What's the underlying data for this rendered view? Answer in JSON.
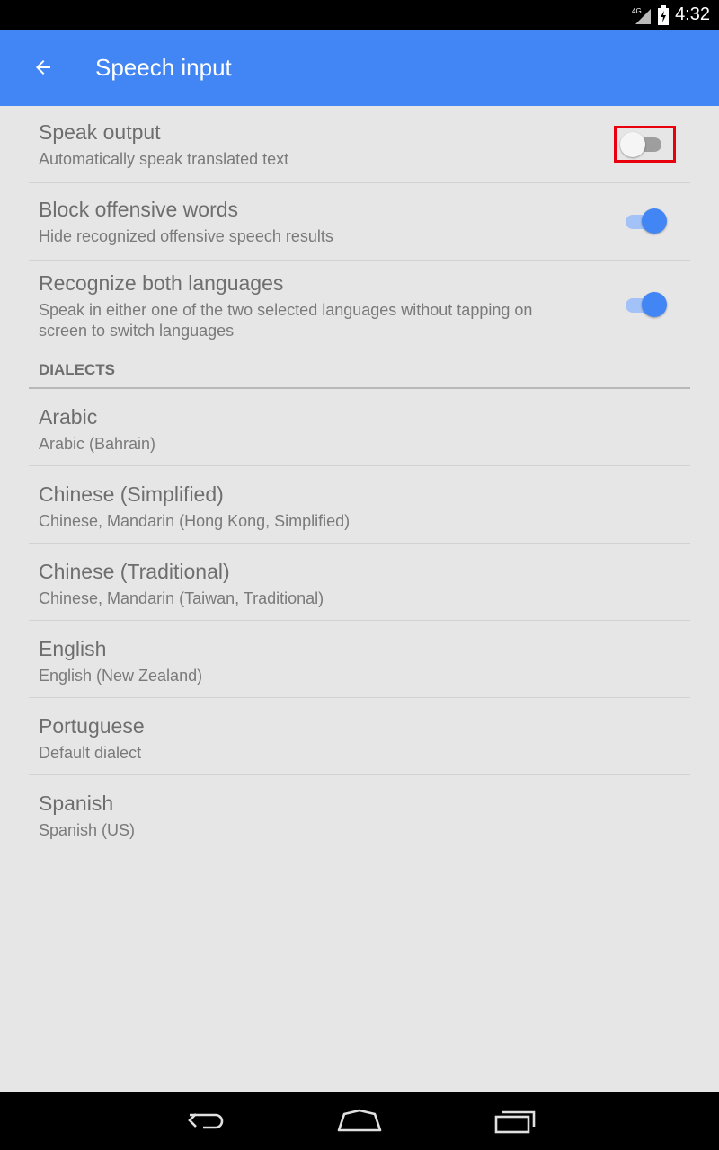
{
  "status_bar": {
    "network": "4G",
    "time": "4:32"
  },
  "app_bar": {
    "title": "Speech input",
    "back_icon": "arrow-back-icon"
  },
  "preferences": [
    {
      "title": "Speak output",
      "summary": "Automatically speak translated text",
      "enabled": false
    },
    {
      "title": "Block offensive words",
      "summary": "Hide recognized offensive speech results",
      "enabled": true
    },
    {
      "title": "Recognize both languages",
      "summary_line1": "Speak in either one of the two selected languages without tapping on",
      "summary_line2": "screen to switch languages",
      "enabled": true
    }
  ],
  "dialects": {
    "header": "DIALECTS",
    "items": [
      {
        "language": "Arabic",
        "dialect": "Arabic (Bahrain)"
      },
      {
        "language": "Chinese (Simplified)",
        "dialect": "Chinese, Mandarin (Hong Kong, Simplified)"
      },
      {
        "language": "Chinese (Traditional)",
        "dialect": "Chinese, Mandarin (Taiwan, Traditional)"
      },
      {
        "language": "English",
        "dialect": "English (New Zealand)"
      },
      {
        "language": "Portuguese",
        "dialect": "Default dialect"
      },
      {
        "language": "Spanish",
        "dialect": "Spanish (US)"
      }
    ]
  },
  "colors": {
    "accent": "#4285f4",
    "highlight": "#e8000c",
    "background": "#e6e6e6"
  }
}
